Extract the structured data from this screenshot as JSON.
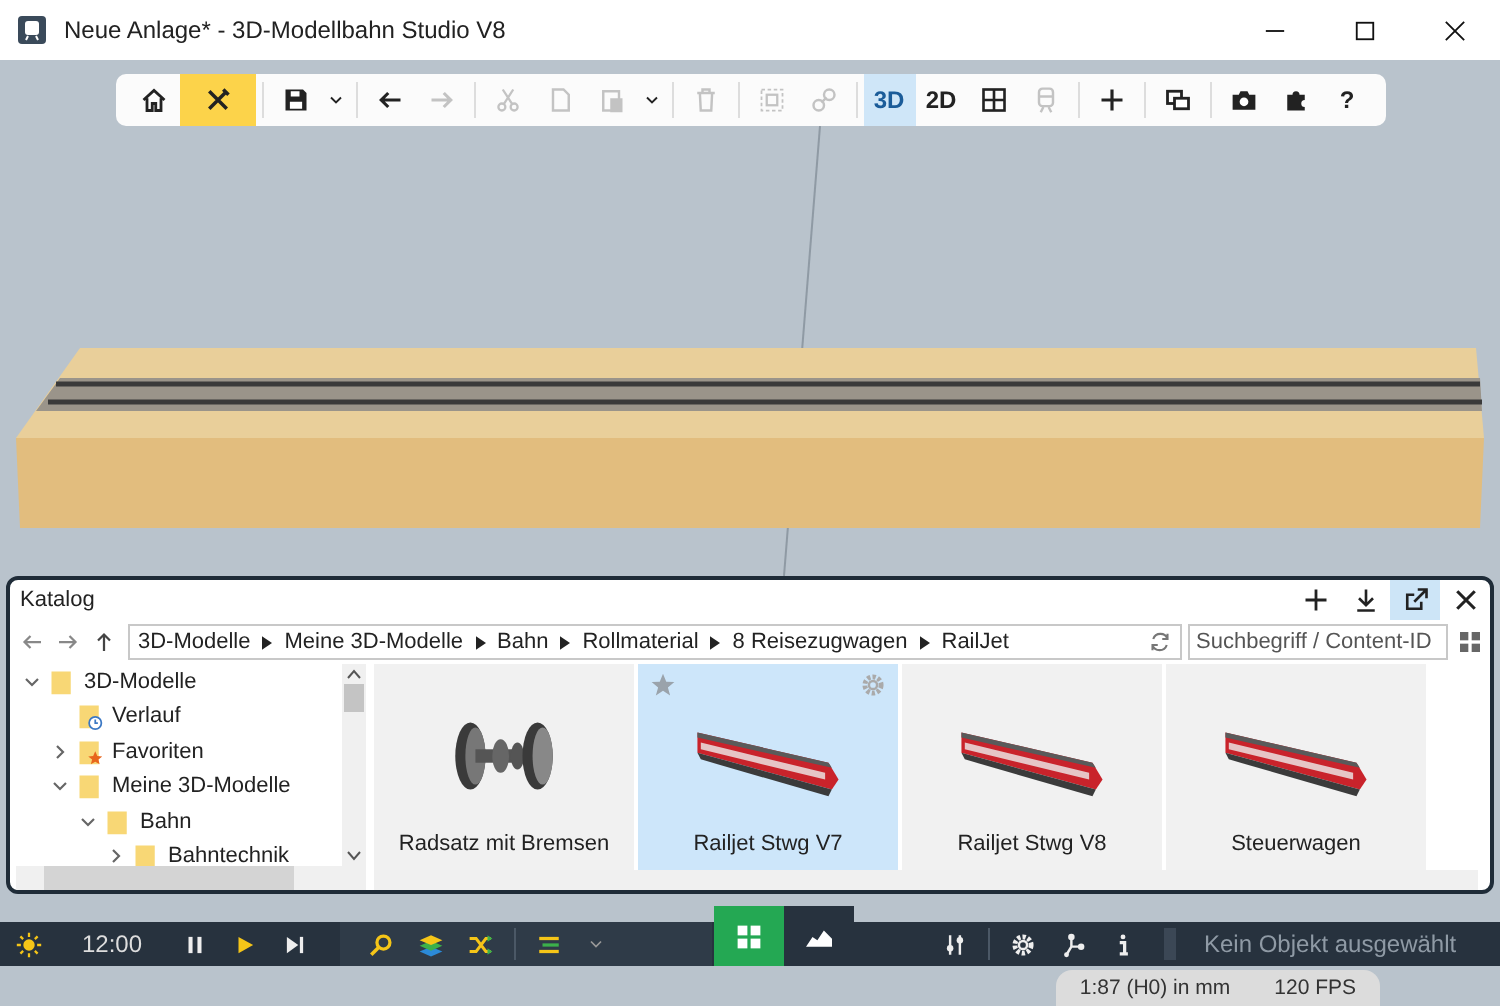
{
  "window": {
    "title": "Neue Anlage* - 3D-Modellbahn Studio V8"
  },
  "toolbar": {
    "groups": [
      [
        {
          "selected": false,
          "disabled": false
        },
        {
          "selected": true,
          "disabled": false
        }
      ],
      [
        {
          "selected": false,
          "disabled": false
        },
        {
          "selected": false,
          "disabled": false
        }
      ],
      [
        {
          "selected": false,
          "disabled": false
        },
        {
          "selected": false,
          "disabled": true
        }
      ],
      [
        {
          "selected": false,
          "disabled": true
        },
        {
          "selected": false,
          "disabled": true
        },
        {
          "selected": false,
          "disabled": true
        },
        {
          "selected": false,
          "disabled": false
        }
      ],
      [
        {
          "selected": false,
          "disabled": true
        }
      ],
      [
        {
          "selected": false,
          "disabled": true
        },
        {
          "selected": false,
          "disabled": true
        }
      ],
      [
        {
          "label": "3D",
          "selected": true,
          "disabled": false
        },
        {
          "label": "2D",
          "selected": false,
          "disabled": false
        },
        {
          "selected": false,
          "disabled": false
        },
        {
          "selected": false,
          "disabled": true
        }
      ],
      [
        {
          "selected": false,
          "disabled": false
        }
      ],
      [
        {
          "selected": false,
          "disabled": false
        }
      ],
      [
        {
          "selected": false,
          "disabled": false
        },
        {
          "selected": false,
          "disabled": false
        },
        {
          "label": "?",
          "selected": false,
          "disabled": false
        }
      ]
    ]
  },
  "catalog": {
    "title": "Katalog",
    "header_buttons": [
      {
        "on": false
      },
      {
        "on": false
      },
      {
        "on": true
      },
      {
        "on": false
      }
    ],
    "path": [
      "3D-Modelle",
      "Meine 3D-Modelle",
      "Bahn",
      "Rollmaterial",
      "8 Reisezugwagen",
      "RailJet"
    ],
    "search": {
      "placeholder": "Suchbegriff / Content-ID"
    },
    "tree": [
      {
        "label": "3D-Modelle",
        "expanded": true,
        "children": [
          {
            "label": "Verlauf",
            "kind": "history"
          },
          {
            "label": "Favoriten",
            "kind": "favorites",
            "expanded": false
          },
          {
            "label": "Meine 3D-Modelle",
            "expanded": true,
            "children": [
              {
                "label": "Bahn",
                "expanded": true,
                "children": [
                  {
                    "label": "Bahntechnik",
                    "expanded": false
                  }
                ]
              }
            ]
          }
        ]
      }
    ],
    "tiles": [
      {
        "label": "Radsatz mit Bremsen",
        "kind": "wheelset",
        "selected": false
      },
      {
        "label": "Railjet Stwg V7",
        "kind": "coach",
        "selected": true
      },
      {
        "label": "Railjet Stwg V8",
        "kind": "coach",
        "selected": false
      },
      {
        "label": "Steuerwagen",
        "kind": "coach",
        "selected": false
      }
    ]
  },
  "bottom_bar": {
    "time": "12:00",
    "tabs": [
      {
        "selected": true
      },
      {
        "selected": false
      }
    ],
    "status": "Kein Objekt ausgewählt"
  },
  "status_bar": {
    "scale": "1:87 (H0) in mm",
    "fps": "120 FPS"
  }
}
